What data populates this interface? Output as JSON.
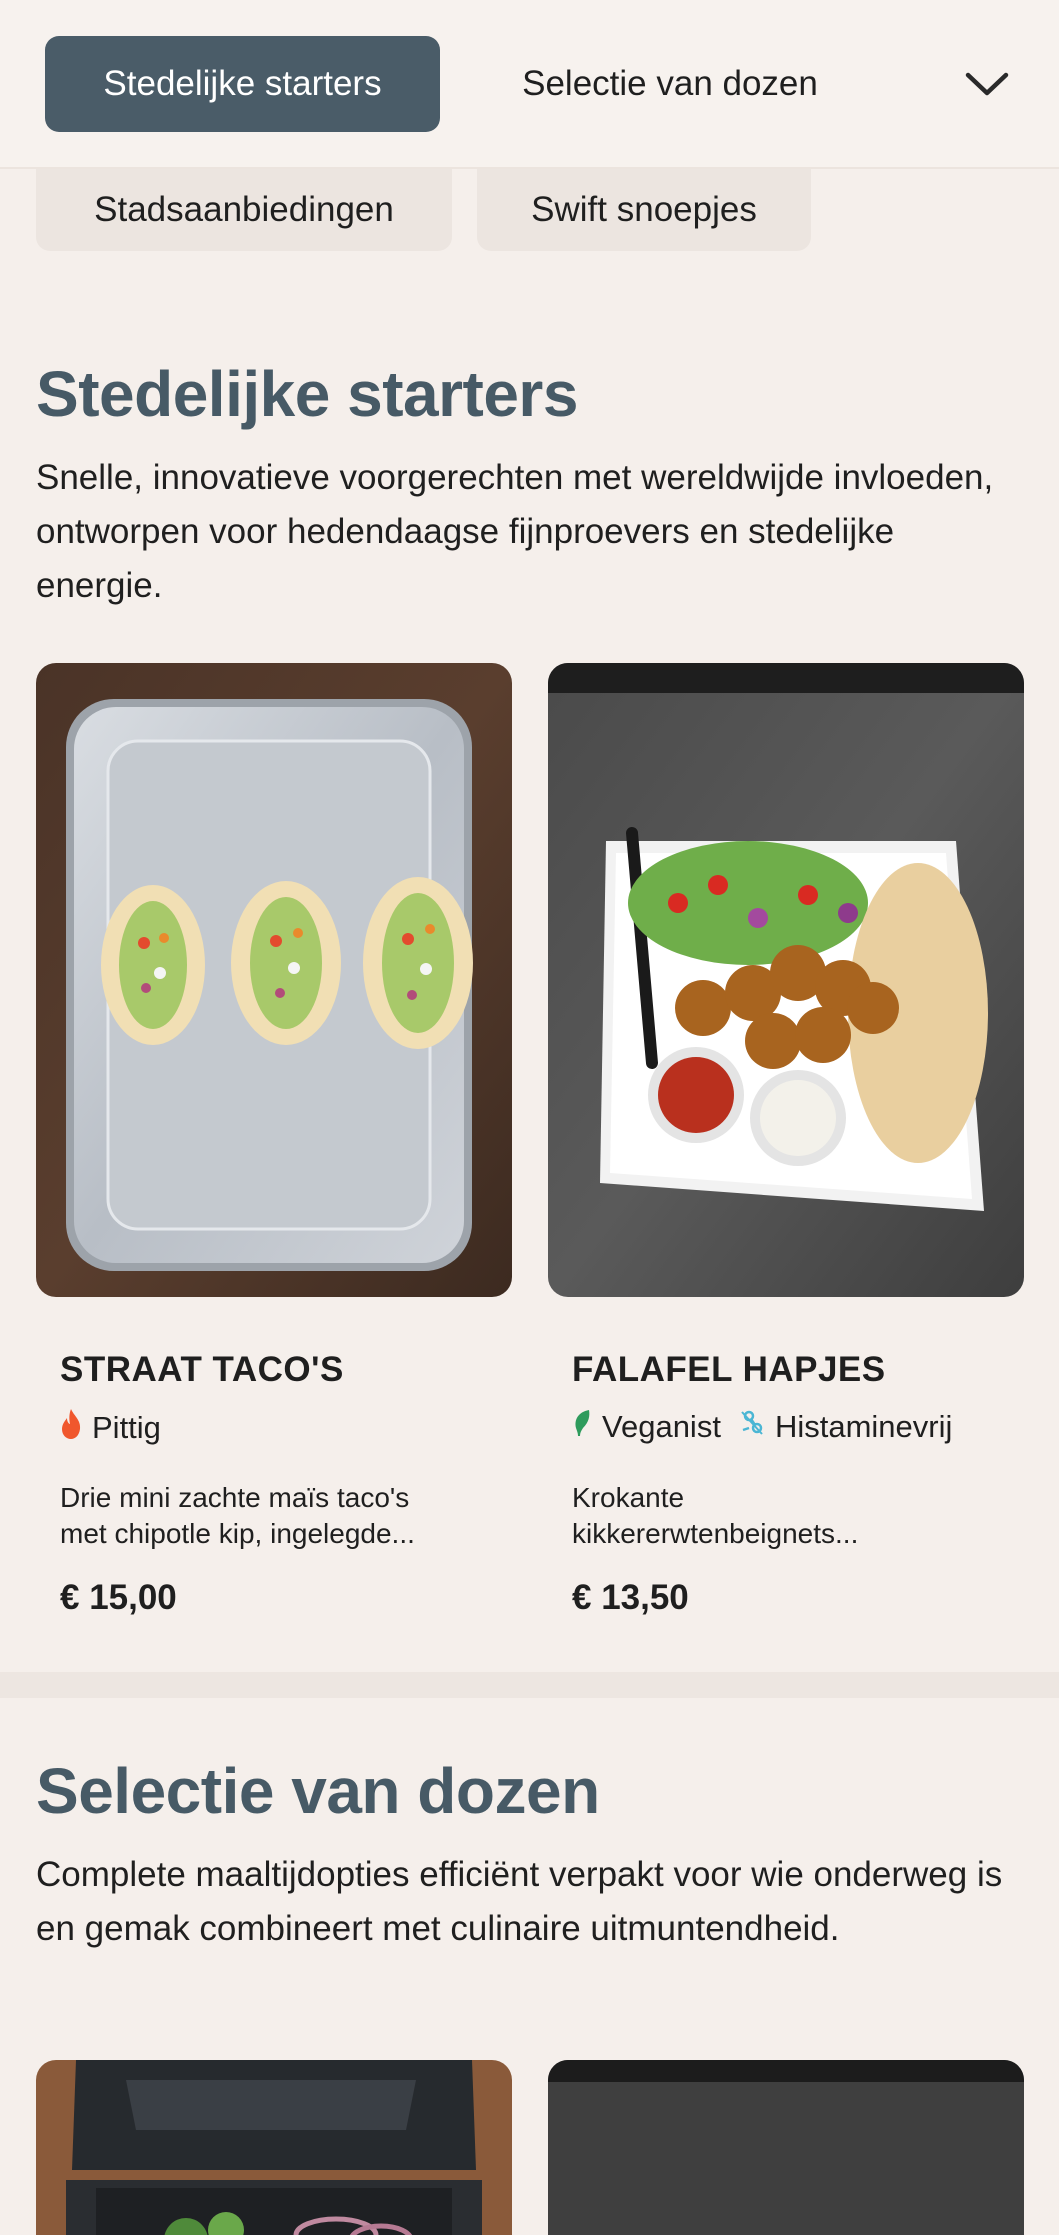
{
  "nav": {
    "active_category": "Stedelijke starters",
    "second_category": "Selectie van dozen",
    "expand_icon": "chevron-down-icon",
    "more_categories": [
      "Stadsaanbiedingen",
      "Swift snoepjes"
    ]
  },
  "sections": [
    {
      "title": "Stedelijke starters",
      "description": "Snelle, innovatieve voorgerechten met wereldwijde invloeden, ontworpen voor hedendaagse fijnproevers en stedelijke energie.",
      "products": [
        {
          "name": "STRAAT TACO'S",
          "tags": [
            {
              "label": "Pittig",
              "icon": "flame-icon",
              "color": "#f0572d"
            }
          ],
          "description_line1": "Drie mini zachte maïs taco's",
          "description_line2": "met chipotle kip, ingelegde...",
          "price": "€ 15,00"
        },
        {
          "name": "FALAFEL HAPJES",
          "tags": [
            {
              "label": "Veganist",
              "icon": "leaf-icon",
              "color": "#2e9b5c"
            },
            {
              "label": "Histaminevrij",
              "icon": "histamine-free-icon",
              "color": "#4bb6d4"
            }
          ],
          "description_line1": "Krokante",
          "description_line2": "kikkererwtenbeignets...",
          "price": "€ 13,50"
        }
      ]
    },
    {
      "title": "Selectie van dozen",
      "description": "Complete maaltijdopties efficiënt verpakt voor wie onderweg is en gemak combineert met culinaire uitmuntendheid."
    }
  ],
  "colors": {
    "background": "#f5efeb",
    "accent": "#4a5c68",
    "heading": "#475a66"
  }
}
